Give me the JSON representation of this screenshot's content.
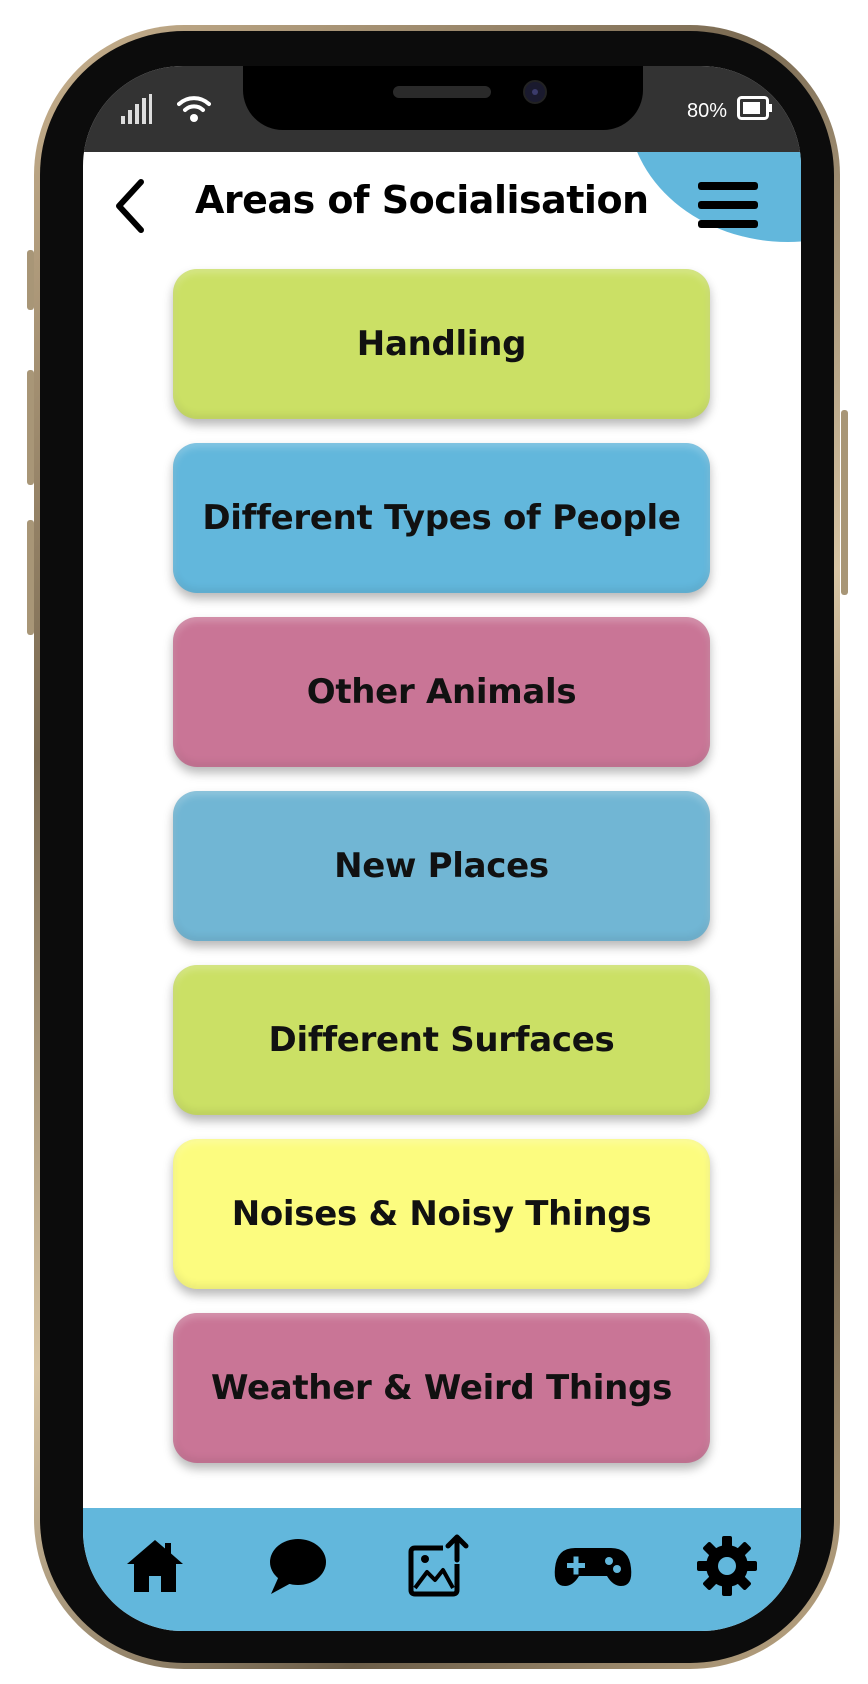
{
  "status_bar": {
    "battery_percent": "80%",
    "signal_icon": "signal-bars-icon",
    "wifi_icon": "wifi-icon",
    "battery_icon": "battery-icon"
  },
  "header": {
    "title": "Areas of Socialisation",
    "back_icon": "chevron-left-icon",
    "menu_icon": "hamburger-menu-icon",
    "accent_color": "#62b7dc"
  },
  "categories": [
    {
      "label": "Handling",
      "color": "#cbe065"
    },
    {
      "label": "Different Types of People",
      "color": "#62b7dc"
    },
    {
      "label": "Other Animals",
      "color": "#c97596"
    },
    {
      "label": "New Places",
      "color": "#71b6d4"
    },
    {
      "label": "Different Surfaces",
      "color": "#cbe065"
    },
    {
      "label": "Noises & Noisy Things",
      "color": "#fcfc7f"
    },
    {
      "label": "Weather & Weird Things",
      "color": "#c97596"
    }
  ],
  "bottom_nav": {
    "background": "#62b7dc",
    "items": [
      {
        "icon": "home-icon"
      },
      {
        "icon": "chat-bubble-icon"
      },
      {
        "icon": "image-upload-icon"
      },
      {
        "icon": "gamepad-icon"
      },
      {
        "icon": "settings-gear-icon"
      }
    ]
  }
}
